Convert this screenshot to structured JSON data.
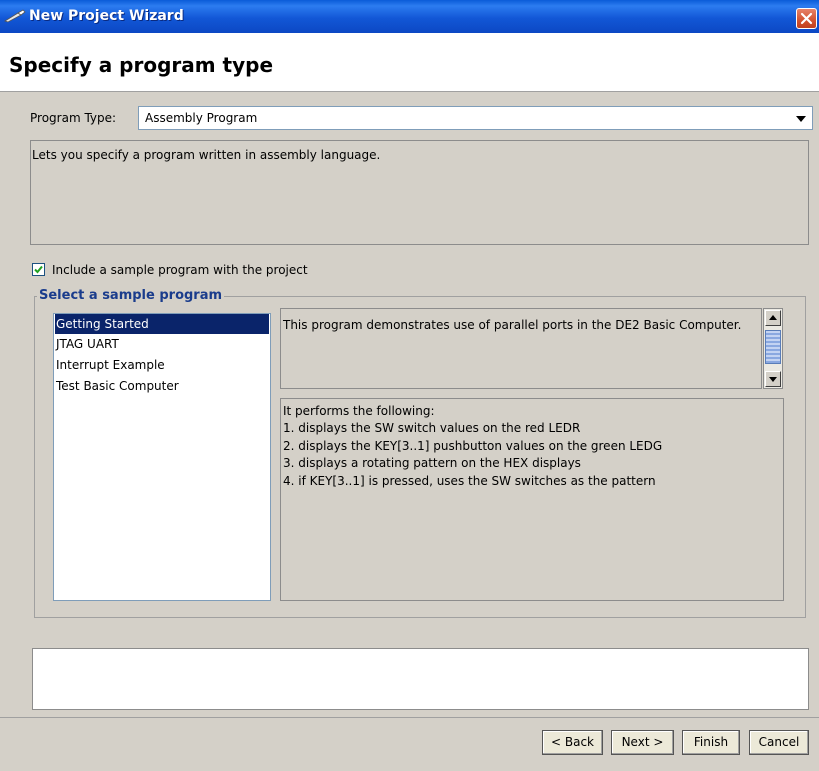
{
  "window": {
    "title": "New Project Wizard",
    "accent_color": "#0a5bd8",
    "icons": {
      "app": "wand-icon",
      "close": "close-icon"
    }
  },
  "header": {
    "title": "Specify a program type"
  },
  "program_type": {
    "label": "Program Type:",
    "selected": "Assembly Program",
    "description": "Lets you specify a program written in assembly language."
  },
  "include_sample": {
    "label": "Include a sample program with the project",
    "checked": true
  },
  "sample_group": {
    "title": "Select a sample program",
    "programs": [
      {
        "label": "Getting Started",
        "selected": true
      },
      {
        "label": "JTAG UART",
        "selected": false
      },
      {
        "label": "Interrupt Example",
        "selected": false
      },
      {
        "label": "Test Basic Computer",
        "selected": false
      }
    ],
    "summary": "This program demonstrates use of parallel ports in the DE2 Basic Computer.",
    "details": [
      "It performs the following:",
      "1. displays the SW switch values on the red LEDR",
      "2. displays the KEY[3..1] pushbutton values on the green LEDG",
      "3. displays a rotating pattern on the HEX displays",
      "4. if KEY[3..1] is pressed, uses the SW switches as the pattern"
    ]
  },
  "message": "",
  "buttons": {
    "back": "< Back",
    "next": "Next >",
    "finish": "Finish",
    "cancel": "Cancel"
  }
}
